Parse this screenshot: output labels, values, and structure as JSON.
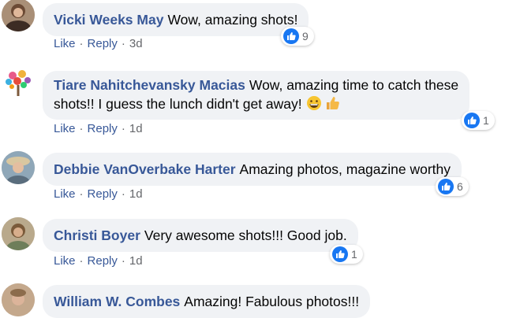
{
  "accent_color": "#1877f2",
  "name_color": "#385898",
  "comments": [
    {
      "name": "Vicki Weeks May",
      "text": "Wow, amazing shots!",
      "like": "Like",
      "reply": "Reply",
      "time": "3d",
      "reactions": "9",
      "avatar_icon": "avatar-photo"
    },
    {
      "name": "Tiare Nahitchevansky Macias",
      "text": "Wow, amazing time to catch these",
      "text2": "shots!! I guess the lunch didn't get away!",
      "emojis": [
        "grinning-face-icon",
        "thumbs-up-icon"
      ],
      "like": "Like",
      "reply": "Reply",
      "time": "1d",
      "reactions": "1",
      "avatar_icon": "floral-tree-avatar"
    },
    {
      "name": "Debbie VanOverbake Harter",
      "text": "Amazing photos, magazine worthy",
      "like": "Like",
      "reply": "Reply",
      "time": "1d",
      "reactions": "6",
      "avatar_icon": "avatar-photo"
    },
    {
      "name": "Christi Boyer",
      "text": "Very awesome shots!!! Good job.",
      "like": "Like",
      "reply": "Reply",
      "time": "1d",
      "reactions": "1",
      "avatar_icon": "avatar-photo"
    },
    {
      "name": "William W. Combes",
      "text": "Amazing! Fabulous photos!!!",
      "avatar_icon": "avatar-photo"
    }
  ]
}
